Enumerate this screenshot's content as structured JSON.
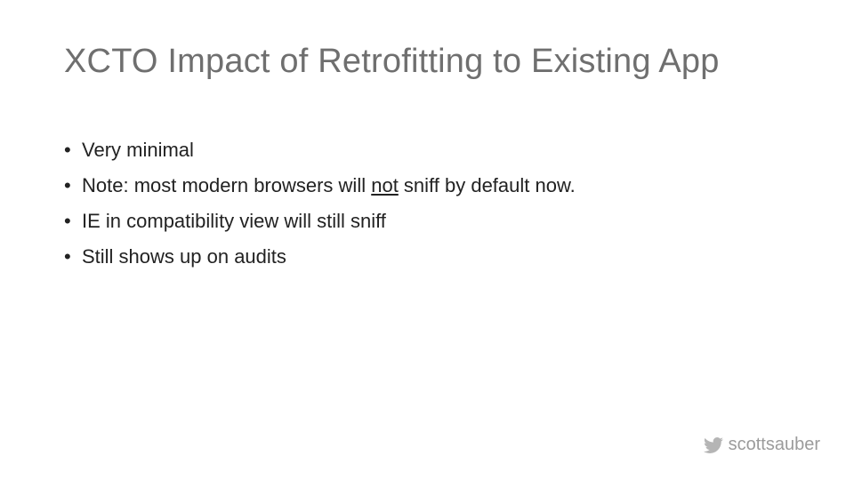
{
  "title": "XCTO Impact of Retrofitting to Existing App",
  "bullets": [
    {
      "segments": [
        {
          "text": "Very minimal"
        }
      ]
    },
    {
      "segments": [
        {
          "text": "Note: most modern browsers will "
        },
        {
          "text": "not",
          "u": true
        },
        {
          "text": " sniff by default now."
        }
      ]
    },
    {
      "segments": [
        {
          "text": "IE in compatibility view will still sniff"
        }
      ]
    },
    {
      "segments": [
        {
          "text": "Still shows up on audits"
        }
      ]
    }
  ],
  "footer": {
    "handle": "scottsauber"
  },
  "colors": {
    "title": "#6f6f6f",
    "body": "#222222",
    "footer": "#9b9b9b"
  }
}
